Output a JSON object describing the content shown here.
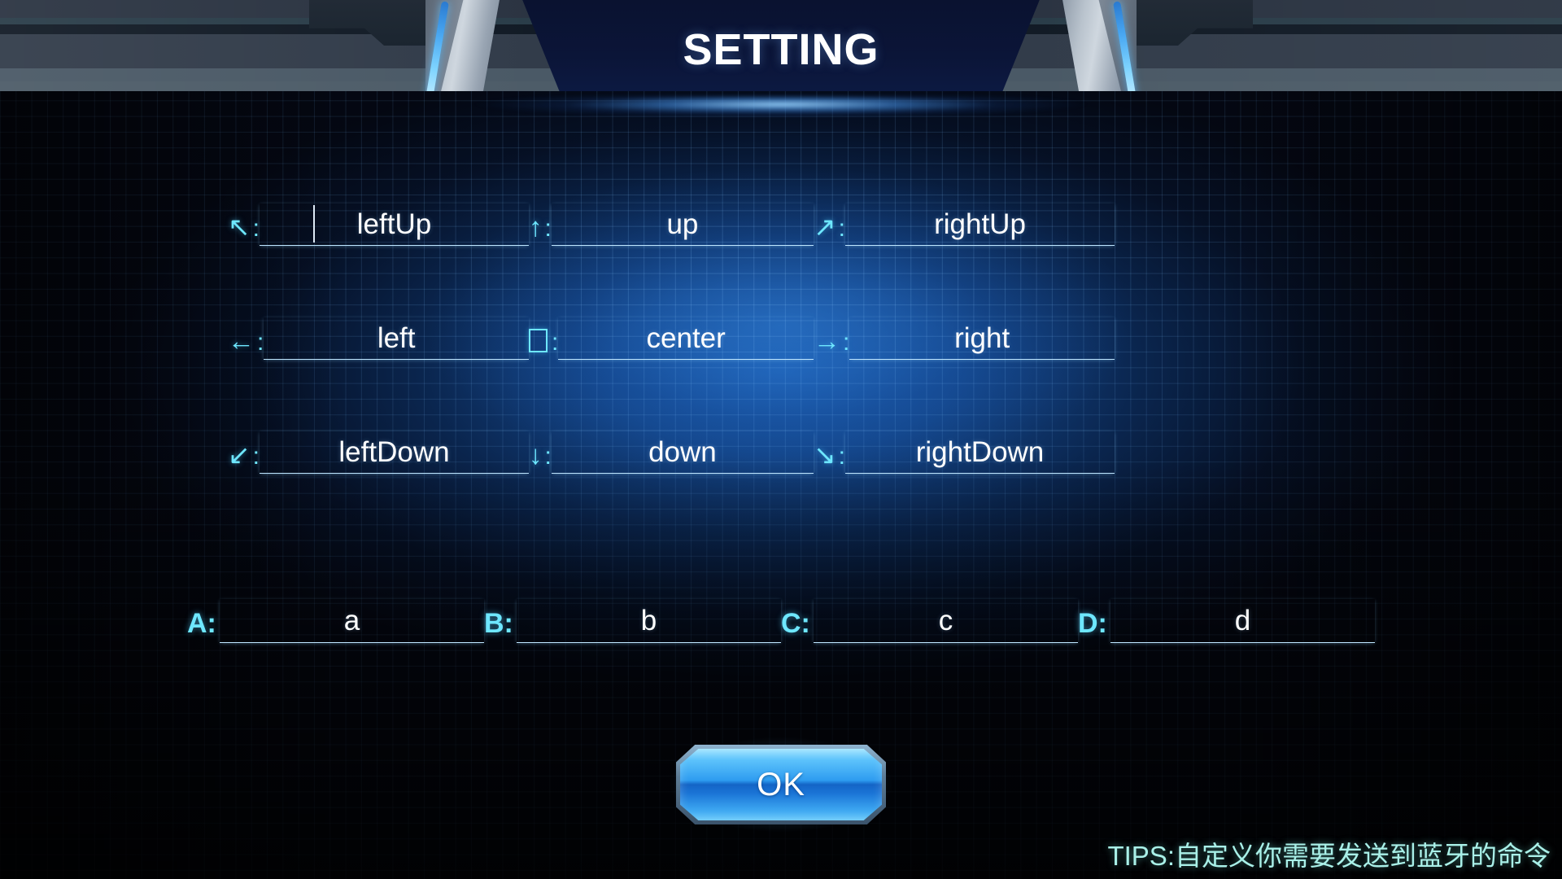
{
  "header": {
    "title": "SETTING"
  },
  "direction_fields": [
    {
      "icon": "arrow-up-left-icon",
      "glyph": "↖",
      "colon": ":",
      "value": "leftUp",
      "name": "leftup",
      "has_caret": true
    },
    {
      "icon": "arrow-up-icon",
      "glyph": "↑",
      "colon": ":",
      "value": "up",
      "name": "up",
      "has_caret": false
    },
    {
      "icon": "arrow-up-right-icon",
      "glyph": "↗",
      "colon": ":",
      "value": "rightUp",
      "name": "rightup",
      "has_caret": false
    },
    {
      "icon": "arrow-left-icon",
      "glyph": "←",
      "colon": ":",
      "value": "left",
      "name": "left",
      "has_caret": false
    },
    {
      "icon": "square-box-icon",
      "glyph": "",
      "colon": ":",
      "value": "center",
      "name": "center",
      "has_caret": false
    },
    {
      "icon": "arrow-right-icon",
      "glyph": "→",
      "colon": ":",
      "value": "right",
      "name": "right",
      "has_caret": false
    },
    {
      "icon": "arrow-down-left-icon",
      "glyph": "↙",
      "colon": ":",
      "value": "leftDown",
      "name": "leftdown",
      "has_caret": false
    },
    {
      "icon": "arrow-down-icon",
      "glyph": "↓",
      "colon": ":",
      "value": "down",
      "name": "down",
      "has_caret": false
    },
    {
      "icon": "arrow-down-right-icon",
      "glyph": "↘",
      "colon": ":",
      "value": "rightDown",
      "name": "rightdown",
      "has_caret": false
    }
  ],
  "button_fields": [
    {
      "label": "A:",
      "value": "a",
      "name": "a"
    },
    {
      "label": "B:",
      "value": "b",
      "name": "b"
    },
    {
      "label": "C:",
      "value": "c",
      "name": "c"
    },
    {
      "label": "D:",
      "value": "d",
      "name": "d"
    }
  ],
  "ok_button": {
    "label": "OK"
  },
  "tips": {
    "text": "TIPS:自定义你需要发送到蓝牙的命令"
  },
  "colors": {
    "accent_cyan": "#6ee7ff",
    "value_white": "#ffffff",
    "underline": "#bfe6ff",
    "tips_text": "#a9f0e8",
    "bg_navy": "#040711",
    "glow_blue": "#1c60b6",
    "button_light": "#9fe4ff",
    "button_dark": "#1464c6",
    "title_panel": "#0b1538"
  }
}
